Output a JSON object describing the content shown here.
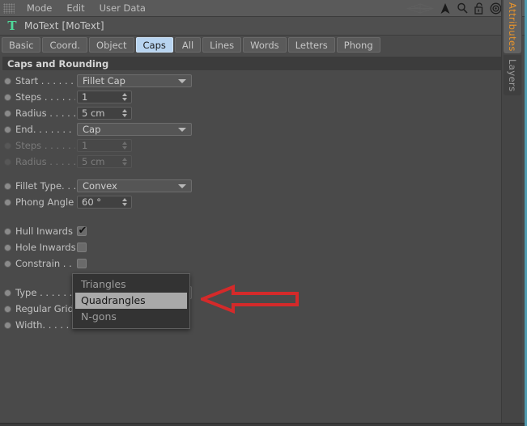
{
  "menubar": {
    "grip_icon": "grip-dots-icon",
    "items": [
      {
        "label": "Mode"
      },
      {
        "label": "Edit"
      },
      {
        "label": "User Data"
      }
    ],
    "icons": [
      {
        "name": "wireframe-icon"
      },
      {
        "name": "cursor-arrow-icon"
      },
      {
        "name": "search-icon"
      },
      {
        "name": "unlock-icon"
      },
      {
        "name": "target-icon"
      },
      {
        "name": "plus-box-icon"
      }
    ]
  },
  "object": {
    "icon": "motext-T-icon",
    "title": "MoText [MoText]"
  },
  "tabs": [
    {
      "label": "Basic",
      "active": false
    },
    {
      "label": "Coord.",
      "active": false
    },
    {
      "label": "Object",
      "active": false
    },
    {
      "label": "Caps",
      "active": true
    },
    {
      "label": "All",
      "active": false
    },
    {
      "label": "Lines",
      "active": false
    },
    {
      "label": "Words",
      "active": false
    },
    {
      "label": "Letters",
      "active": false
    },
    {
      "label": "Phong",
      "active": false
    }
  ],
  "group": {
    "title": "Caps and Rounding"
  },
  "properties": {
    "start": {
      "label": "Start . . . . . . .",
      "value": "Fillet Cap"
    },
    "steps1": {
      "label": "Steps . . . . . .",
      "value": "1"
    },
    "radius1": {
      "label": "Radius . . . . .",
      "value": "5 cm"
    },
    "end": {
      "label": "End. . . . . . . .",
      "value": "Cap"
    },
    "steps2": {
      "label": "Steps . . . . . .",
      "value": "1"
    },
    "radius2": {
      "label": "Radius . . . . .",
      "value": "5 cm"
    },
    "fillet_type": {
      "label": "Fillet Type. . .",
      "value": "Convex"
    },
    "phong_angle": {
      "label": "Phong Angle",
      "value": "60 °"
    },
    "hull_inwards": {
      "label": "Hull Inwards",
      "checked": true
    },
    "hole_inwards": {
      "label": "Hole Inwards",
      "checked": false
    },
    "constrain": {
      "label": "Constrain . . .",
      "checked": false
    },
    "type": {
      "label": "Type . . . . . . .",
      "value": "Quadrangles"
    },
    "regular_grid": {
      "label": "Regular Grid"
    },
    "width": {
      "label": "Width. . . . . . ."
    }
  },
  "type_dropdown": {
    "open": true,
    "options": [
      {
        "label": "Triangles",
        "selected": false
      },
      {
        "label": "Quadrangles",
        "selected": true
      },
      {
        "label": "N-gons",
        "selected": false
      }
    ]
  },
  "annotation": {
    "name": "red-arrow-annotation",
    "color": "#d42a2a",
    "direction": "left"
  },
  "side_tabs": [
    {
      "label": "Attributes",
      "active": true,
      "color": "#e8942c"
    },
    {
      "label": "Layers",
      "active": false,
      "color": "#9a9a9a"
    }
  ]
}
